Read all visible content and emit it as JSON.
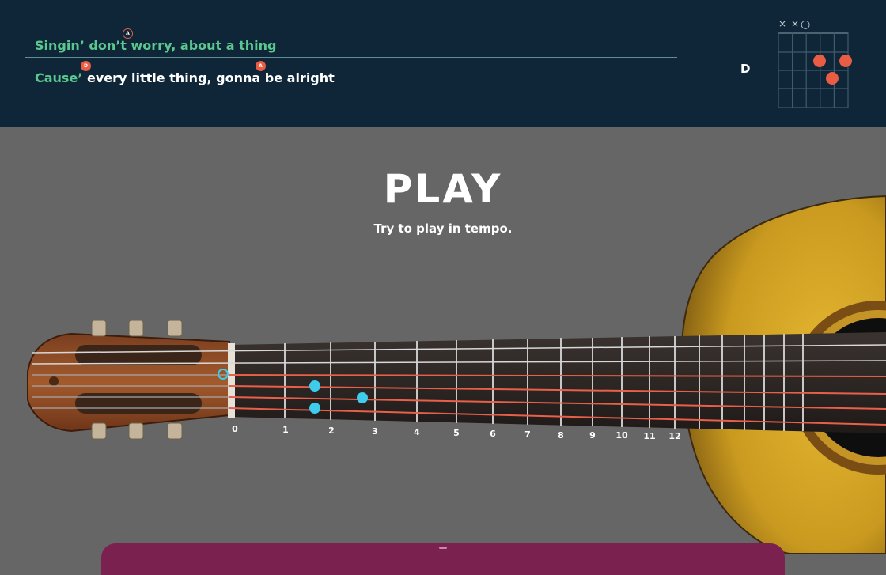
{
  "lyrics": {
    "line1": {
      "sung": "Singin’ don’t worry, about a thing",
      "unsung": ""
    },
    "line2": {
      "sung": "Cause’",
      "unsung": " every little thing, gonna be alright"
    },
    "markers": [
      {
        "label": "A",
        "style": "outline"
      },
      {
        "label": "D",
        "style": "filled"
      },
      {
        "label": "A",
        "style": "filled"
      }
    ]
  },
  "current_chord": {
    "name": "D",
    "muted_symbol": "×",
    "open_symbol": "○"
  },
  "prompt": {
    "title": "PLAY",
    "subtitle": "Try to play in tempo."
  },
  "fretboard": {
    "fret_numbers": [
      "0",
      "1",
      "2",
      "3",
      "4",
      "5",
      "6",
      "7",
      "8",
      "9",
      "10",
      "11",
      "12"
    ],
    "active_string_color": "#e8604a",
    "finger_dot_color": "#3ecbec"
  },
  "colors": {
    "topbar": "#0f2638",
    "sung_text": "#5ac88f",
    "marker": "#e85d44",
    "background": "#666666",
    "bottom_panel": "#7b2150"
  }
}
